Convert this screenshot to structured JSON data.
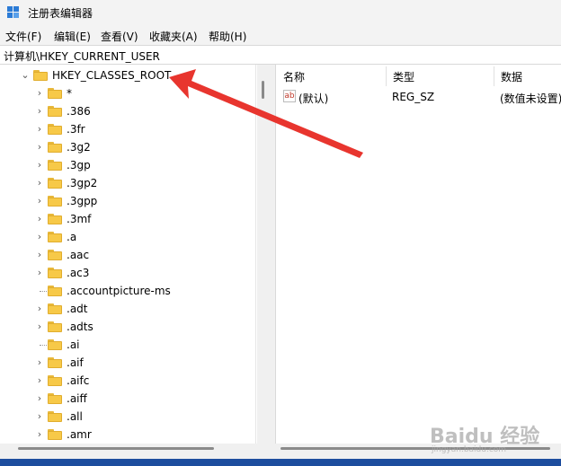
{
  "window": {
    "title": "注册表编辑器"
  },
  "menu": [
    {
      "label": "文件(F)"
    },
    {
      "label": "编辑(E)"
    },
    {
      "label": "查看(V)"
    },
    {
      "label": "收藏夹(A)"
    },
    {
      "label": "帮助(H)"
    }
  ],
  "address": {
    "path": "计算机\\HKEY_CURRENT_USER"
  },
  "tree": {
    "root": {
      "label": "HKEY_CLASSES_ROOT",
      "expanded": true
    },
    "children": [
      {
        "label": "*",
        "has_children": true
      },
      {
        "label": ".386",
        "has_children": true
      },
      {
        "label": ".3fr",
        "has_children": true
      },
      {
        "label": ".3g2",
        "has_children": true
      },
      {
        "label": ".3gp",
        "has_children": true
      },
      {
        "label": ".3gp2",
        "has_children": true
      },
      {
        "label": ".3gpp",
        "has_children": true
      },
      {
        "label": ".3mf",
        "has_children": true
      },
      {
        "label": ".a",
        "has_children": true
      },
      {
        "label": ".aac",
        "has_children": true
      },
      {
        "label": ".ac3",
        "has_children": true
      },
      {
        "label": ".accountpicture-ms",
        "has_children": false
      },
      {
        "label": ".adt",
        "has_children": true
      },
      {
        "label": ".adts",
        "has_children": true
      },
      {
        "label": ".ai",
        "has_children": false
      },
      {
        "label": ".aif",
        "has_children": true
      },
      {
        "label": ".aifc",
        "has_children": true
      },
      {
        "label": ".aiff",
        "has_children": true
      },
      {
        "label": ".all",
        "has_children": true
      },
      {
        "label": ".amr",
        "has_children": true
      }
    ]
  },
  "values_list": {
    "columns": [
      {
        "label": "名称"
      },
      {
        "label": "类型"
      },
      {
        "label": "数据"
      }
    ],
    "rows": [
      {
        "icon": "string-value-icon",
        "icon_text": "ab",
        "name": "(默认)",
        "type": "REG_SZ",
        "data": "(数值未设置)"
      }
    ]
  },
  "annotation": {
    "arrow_color": "#e8352e"
  },
  "watermark": {
    "text": "Baidu 经验",
    "sub": "jingyan.baidu.com"
  }
}
